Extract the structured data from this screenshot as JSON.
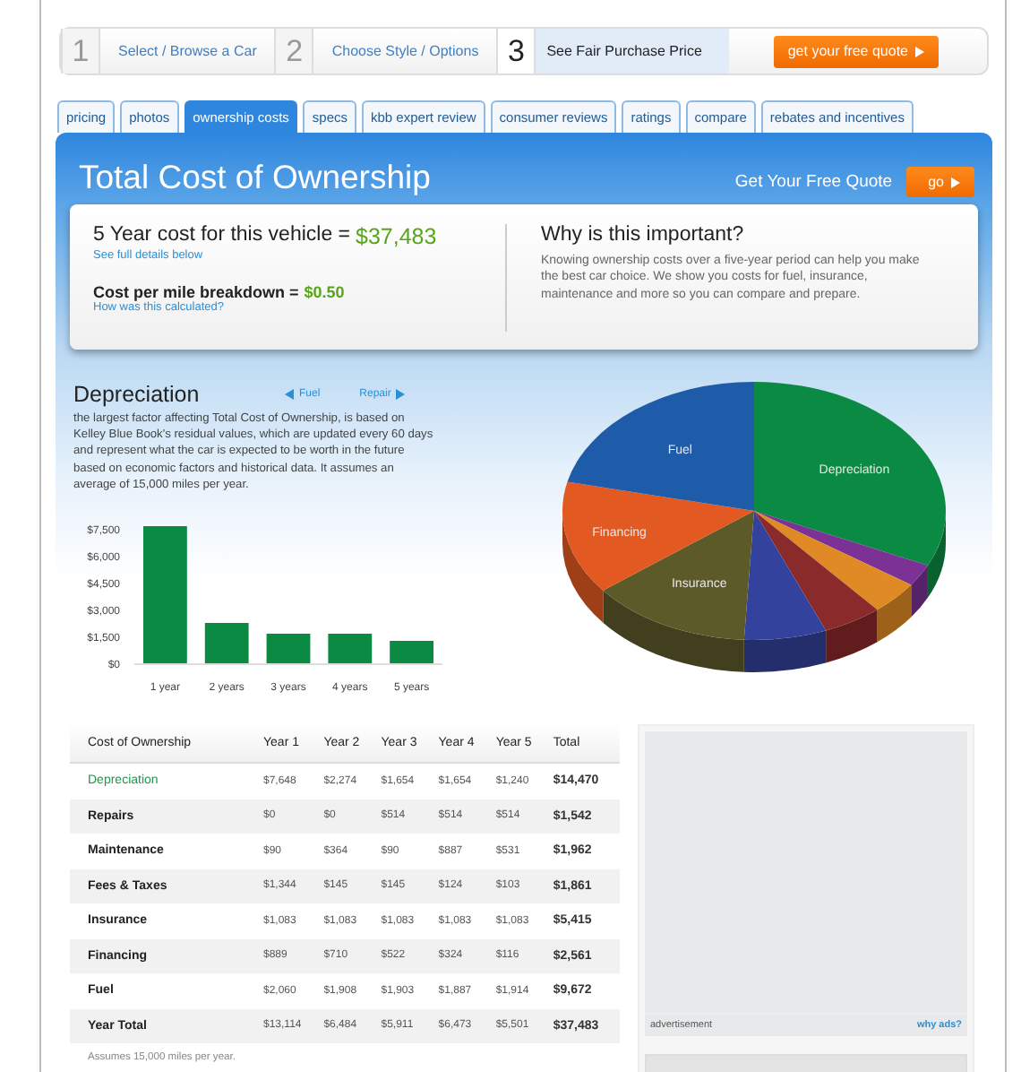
{
  "steps": [
    {
      "number": "1",
      "label": "Select / Browse a Car",
      "selected": false
    },
    {
      "number": "2",
      "label": "Choose Style / Options",
      "selected": false
    },
    {
      "number": "3",
      "label": "See Fair Purchase Price",
      "selected": true
    }
  ],
  "quote_button": "get your free quote",
  "tabs": [
    {
      "label": "pricing",
      "selected": false
    },
    {
      "label": "photos",
      "selected": false
    },
    {
      "label": "ownership costs",
      "selected": true
    },
    {
      "label": "specs",
      "selected": false
    },
    {
      "label": "kbb expert review",
      "selected": false
    },
    {
      "label": "consumer reviews",
      "selected": false
    },
    {
      "label": "ratings",
      "selected": false
    },
    {
      "label": "compare",
      "selected": false
    },
    {
      "label": "rebates and incentives",
      "selected": false
    }
  ],
  "header": {
    "title": "Total Cost of Ownership",
    "quote_label": "Get Your Free Quote",
    "go_button": "go"
  },
  "summary": {
    "five_year_label": "5 Year cost for this vehicle =",
    "five_year_value": "$37,483",
    "details_link": "See full details below",
    "per_mile_label": "Cost per mile breakdown =",
    "per_mile_value": "$0.50",
    "calc_link": "How was this calculated?",
    "why_title": "Why is this important?",
    "why_text": "Knowing ownership costs over a five-year period can help you make the best car choice. We show you costs for fuel, insurance, maintenance and more so you can compare and prepare."
  },
  "depreciation": {
    "title": "Depreciation",
    "prev_link": "Fuel",
    "next_link": "Repair",
    "text": "the largest factor affecting Total Cost of Ownership, is based on Kelley Blue Book's residual values, which are updated every 60 days and represent what the car is expected to be worth in the future based on economic factors and historical data. It assumes an average of 15,000 miles per year.",
    "chart_data": {
      "type": "bar",
      "categories": [
        "1 year",
        "2 years",
        "3 years",
        "4 years",
        "5 years"
      ],
      "values": [
        7650,
        2250,
        1650,
        1650,
        1250
      ],
      "ylim": [
        0,
        7800
      ],
      "yticks": [
        {
          "value": 0,
          "label": "$0"
        },
        {
          "value": 1500,
          "label": "$1,500"
        },
        {
          "value": 3000,
          "label": "$3,000"
        },
        {
          "value": 4500,
          "label": "$4,500"
        },
        {
          "value": 6000,
          "label": "$6,000"
        },
        {
          "value": 7500,
          "label": "$7,500"
        }
      ]
    }
  },
  "pie": {
    "slices": [
      {
        "label": "Depreciation",
        "color": "#0b8a43"
      },
      {
        "color": "#7b3294"
      },
      {
        "color": "#e08a25"
      },
      {
        "color": "#8b2a2a"
      },
      {
        "color": "#33429c"
      },
      {
        "label": "Insurance",
        "color": "#5d5a2a"
      },
      {
        "label": "Financing",
        "color": "#e25a22"
      },
      {
        "label": "Fuel",
        "color": "#1e5ba8"
      }
    ]
  },
  "table": {
    "columns": [
      "Cost of Ownership",
      "Year 1",
      "Year 2",
      "Year 3",
      "Year 4",
      "Year 5",
      "Total"
    ],
    "rows": [
      {
        "name": "Depreciation",
        "selected": true,
        "values": [
          "$7,648",
          "$2,274",
          "$1,654",
          "$1,654",
          "$1,240"
        ],
        "total": "$14,470"
      },
      {
        "name": "Repairs",
        "selected": false,
        "values": [
          "$0",
          "$0",
          "$514",
          "$514",
          "$514"
        ],
        "total": "$1,542"
      },
      {
        "name": "Maintenance",
        "selected": false,
        "values": [
          "$90",
          "$364",
          "$90",
          "$887",
          "$531"
        ],
        "total": "$1,962"
      },
      {
        "name": "Fees & Taxes",
        "selected": false,
        "values": [
          "$1,344",
          "$145",
          "$145",
          "$124",
          "$103"
        ],
        "total": "$1,861"
      },
      {
        "name": "Insurance",
        "selected": false,
        "values": [
          "$1,083",
          "$1,083",
          "$1,083",
          "$1,083",
          "$1,083"
        ],
        "total": "$5,415"
      },
      {
        "name": "Financing",
        "selected": false,
        "values": [
          "$889",
          "$710",
          "$522",
          "$324",
          "$116"
        ],
        "total": "$2,561"
      },
      {
        "name": "Fuel",
        "selected": false,
        "values": [
          "$2,060",
          "$1,908",
          "$1,903",
          "$1,887",
          "$1,914"
        ],
        "total": "$9,672"
      },
      {
        "name": "Year Total",
        "selected": false,
        "values": [
          "$13,114",
          "$6,484",
          "$5,911",
          "$6,473",
          "$5,501"
        ],
        "total": "$37,483"
      }
    ],
    "note": "Assumes 15,000 miles per year."
  },
  "ad": {
    "label": "advertisement",
    "link": "why ads?"
  }
}
